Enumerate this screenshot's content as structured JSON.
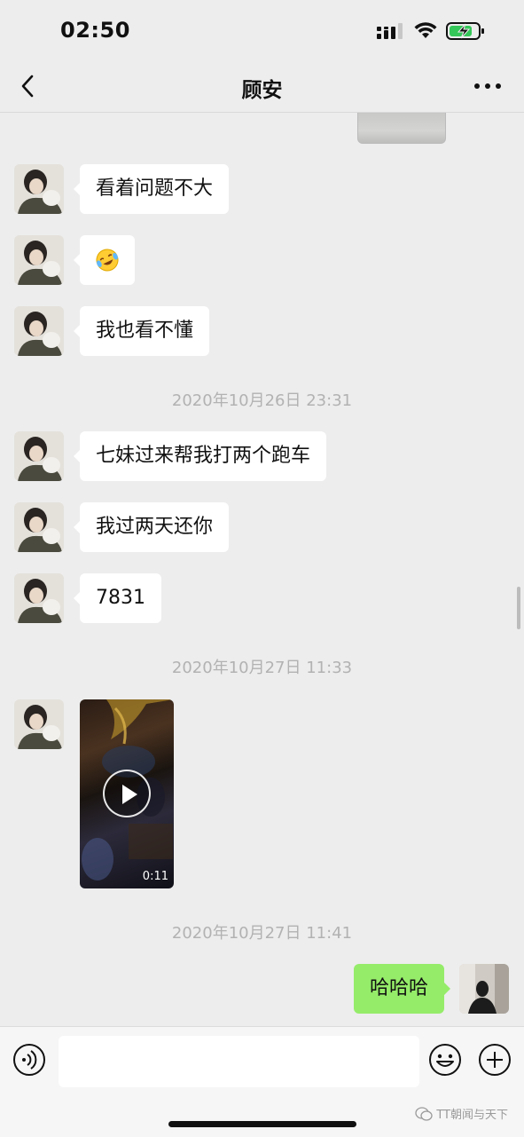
{
  "status_bar": {
    "time": "02:50"
  },
  "header": {
    "title": "顾安"
  },
  "messages": [
    {
      "text": "看着问题不大"
    },
    {
      "emoji": "face-with-tears-of-joy"
    },
    {
      "text": "我也看不懂"
    },
    {
      "text": "七妹过来帮我打两个跑车"
    },
    {
      "text": "我过两天还你"
    },
    {
      "text": "7831"
    },
    {
      "video_duration": "0:11"
    },
    {
      "text": "哈哈哈"
    }
  ],
  "timestamps": [
    "2020年10月26日 23:31",
    "2020年10月27日 11:33",
    "2020年10月27日 11:41"
  ],
  "input_bar": {
    "placeholder": ""
  },
  "watermark": {
    "text": "TT朝闻与天下"
  },
  "colors": {
    "background": "#ededed",
    "bubble_incoming": "#ffffff",
    "bubble_outgoing": "#95ec69",
    "timestamp": "#b2b2b2"
  },
  "icons": [
    "back-icon",
    "more-icon",
    "voice-icon",
    "emoji-icon",
    "plus-icon",
    "play-icon",
    "signal-icon",
    "wifi-icon",
    "battery-charging-icon"
  ]
}
